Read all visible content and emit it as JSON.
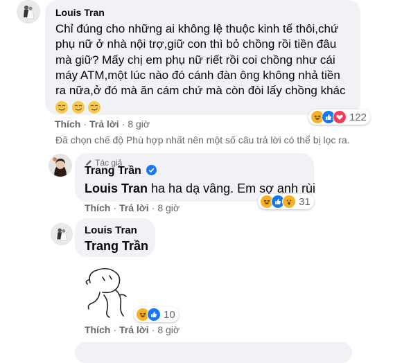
{
  "comment1": {
    "author": "Louis Tran",
    "lines": [
      "Chỉ đúng cho những ai không lệ thuộc kinh tế thôi,chứ",
      "phụ nữ ở nhà nội trợ,giữ con thì bỏ chồng rồi tiền đâu",
      "mà giữ? Mấy chị em phụ nữ riết rồi coi chồng như cái",
      "máy ATM,một lúc nào đó cánh đàn ông không nhả tiền",
      "ra nữa,ở đó mà ăn cám chứ mà còn đòi lấy chồng khác"
    ],
    "emojis": [
      "smirk-emoji",
      "smirk-emoji",
      "smirk-emoji"
    ],
    "like_label": "Thích",
    "reply_label": "Trả lời",
    "time": "8 giờ",
    "reaction_count": "122",
    "reaction_icons": [
      "haha-icon",
      "like-icon",
      "love-icon"
    ]
  },
  "filter_notice": "Đã chọn chế độ Phù hợp nhất nên một số câu trả lời có thể bị lọc ra.",
  "reply1": {
    "badge": "Tác giả",
    "author": "Trang Trần",
    "mention": "Louis Tran",
    "text": " ha ha dạ vâng. Em sợ anh rùi",
    "like_label": "Thích",
    "reply_label": "Trả lời",
    "time": "8 giờ",
    "reaction_count": "31",
    "reaction_icons": [
      "haha-icon",
      "like-icon",
      "wow-icon"
    ]
  },
  "reply2": {
    "author": "Louis Tran",
    "mention": "Trang Trần",
    "sticker": "shrug-line-sticker",
    "like_label": "Thích",
    "reply_label": "Trả lời",
    "time": "8 giờ",
    "reaction_count": "10",
    "reaction_icons": [
      "haha-icon",
      "like-icon"
    ]
  },
  "colors": {
    "bubble": "#f0f2f5",
    "meta_text": "#65676b",
    "verified": "#1877f2",
    "like": "#1877f2",
    "haha": "#f7b125",
    "love": "#f33e58"
  }
}
